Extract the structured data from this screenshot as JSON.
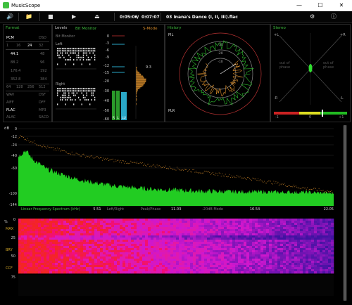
{
  "window": {
    "title": "MusicScope",
    "min": "—",
    "max": "☐",
    "close": "✕"
  },
  "toolbar": {
    "time_elapsed": "0:05:06",
    "time_sep": "/",
    "time_total": "0:07:07",
    "track": "03 Inana's Dance (I, II, III).flac"
  },
  "format": {
    "title": "Format",
    "pcm": "PCM",
    "dsd": "DSD",
    "bits": [
      "1",
      "16",
      "24",
      "32"
    ],
    "rates_left": [
      "44.1",
      "88.2",
      "176.4",
      "352.8"
    ],
    "rates_right": [
      "48",
      "96",
      "192",
      "384"
    ],
    "dsd_rates": [
      "64",
      "128",
      "256",
      "512"
    ],
    "formats": [
      [
        "WAV",
        "DSF"
      ],
      [
        "AIFF",
        "DFF"
      ],
      [
        "FLAC",
        "MP3"
      ],
      [
        "ALAC",
        "SACD"
      ]
    ],
    "active_bits": "24",
    "active_rate": "44.1",
    "active_format": "FLAC"
  },
  "levels": {
    "title": "Levels",
    "bitmonitor": "Bit Monitor",
    "left": "Left",
    "right": "Right",
    "scale": [
      "0",
      "-3",
      "-6",
      "-9",
      "-12",
      "-15",
      "-20",
      "-30",
      "-40",
      "-50",
      "-60"
    ],
    "peak_readout": "9.3",
    "meter_labels": [
      "R",
      "L",
      "LU"
    ]
  },
  "smode": {
    "title": "S-Mode"
  },
  "history": {
    "title": "History",
    "pil": "PIL",
    "plr": "PLR",
    "rings": [
      "-30",
      "-20",
      "-10"
    ]
  },
  "stereo": {
    "title": "Stereo",
    "plus_l": "+L",
    "plus_r": "+R",
    "minus_l": "-R",
    "minus_r": "-L",
    "out_phase_l": "out of phase",
    "out_phase_r": "out of phase",
    "corr_min": "-1",
    "corr_mid": "0",
    "corr_max": "+1"
  },
  "spectrum": {
    "db_label": "dB",
    "y_ticks": [
      "0",
      "-12",
      "-24",
      "-40",
      "-60",
      "-100",
      "-144"
    ],
    "x_caption": "Linear Frequency Spectrum (kHz)",
    "x_ticks": [
      "5.51",
      "11.03",
      "16.54",
      "22.05"
    ],
    "mode_labels": [
      "Left/Right",
      "Peak/Phase",
      "-20dB Mode"
    ]
  },
  "spectrogram": {
    "pct_label": "%",
    "y_ticks": [
      "0",
      "25",
      "50",
      "75"
    ],
    "markers": [
      "MAX",
      "BRY",
      "CCF"
    ]
  },
  "chart_data": {
    "type": "area",
    "title": "",
    "xlabel": "Linear Frequency Spectrum (kHz)",
    "ylabel": "dB",
    "xlim": [
      0,
      22.05
    ],
    "ylim": [
      -144,
      0
    ],
    "x": [
      0.1,
      0.5,
      1.0,
      2.0,
      3.0,
      4.0,
      5.0,
      6.0,
      7.0,
      8.0,
      9.0,
      10.0,
      11.0,
      12.0,
      13.0,
      14.0,
      15.0,
      16.0,
      17.0,
      18.0,
      19.0,
      20.0,
      21.0,
      22.05
    ],
    "series": [
      {
        "values": [
          -40,
          -32,
          -46,
          -62,
          -70,
          -77,
          -82,
          -86,
          -89,
          -91,
          -93,
          -94,
          -95,
          -96,
          -97,
          -97,
          -98,
          -98,
          -98,
          -99,
          -99,
          -99,
          -100,
          -101
        ]
      },
      {
        "values": [
          -12,
          -15,
          -20,
          -28,
          -33,
          -38,
          -42,
          -46,
          -49,
          -52,
          -55,
          -58,
          -61,
          -64,
          -67,
          -70,
          -73,
          -76,
          -80,
          -84,
          -88,
          -92,
          -95,
          -98
        ]
      }
    ],
    "colors": [
      "#22cc22",
      "#d48a2a"
    ]
  }
}
